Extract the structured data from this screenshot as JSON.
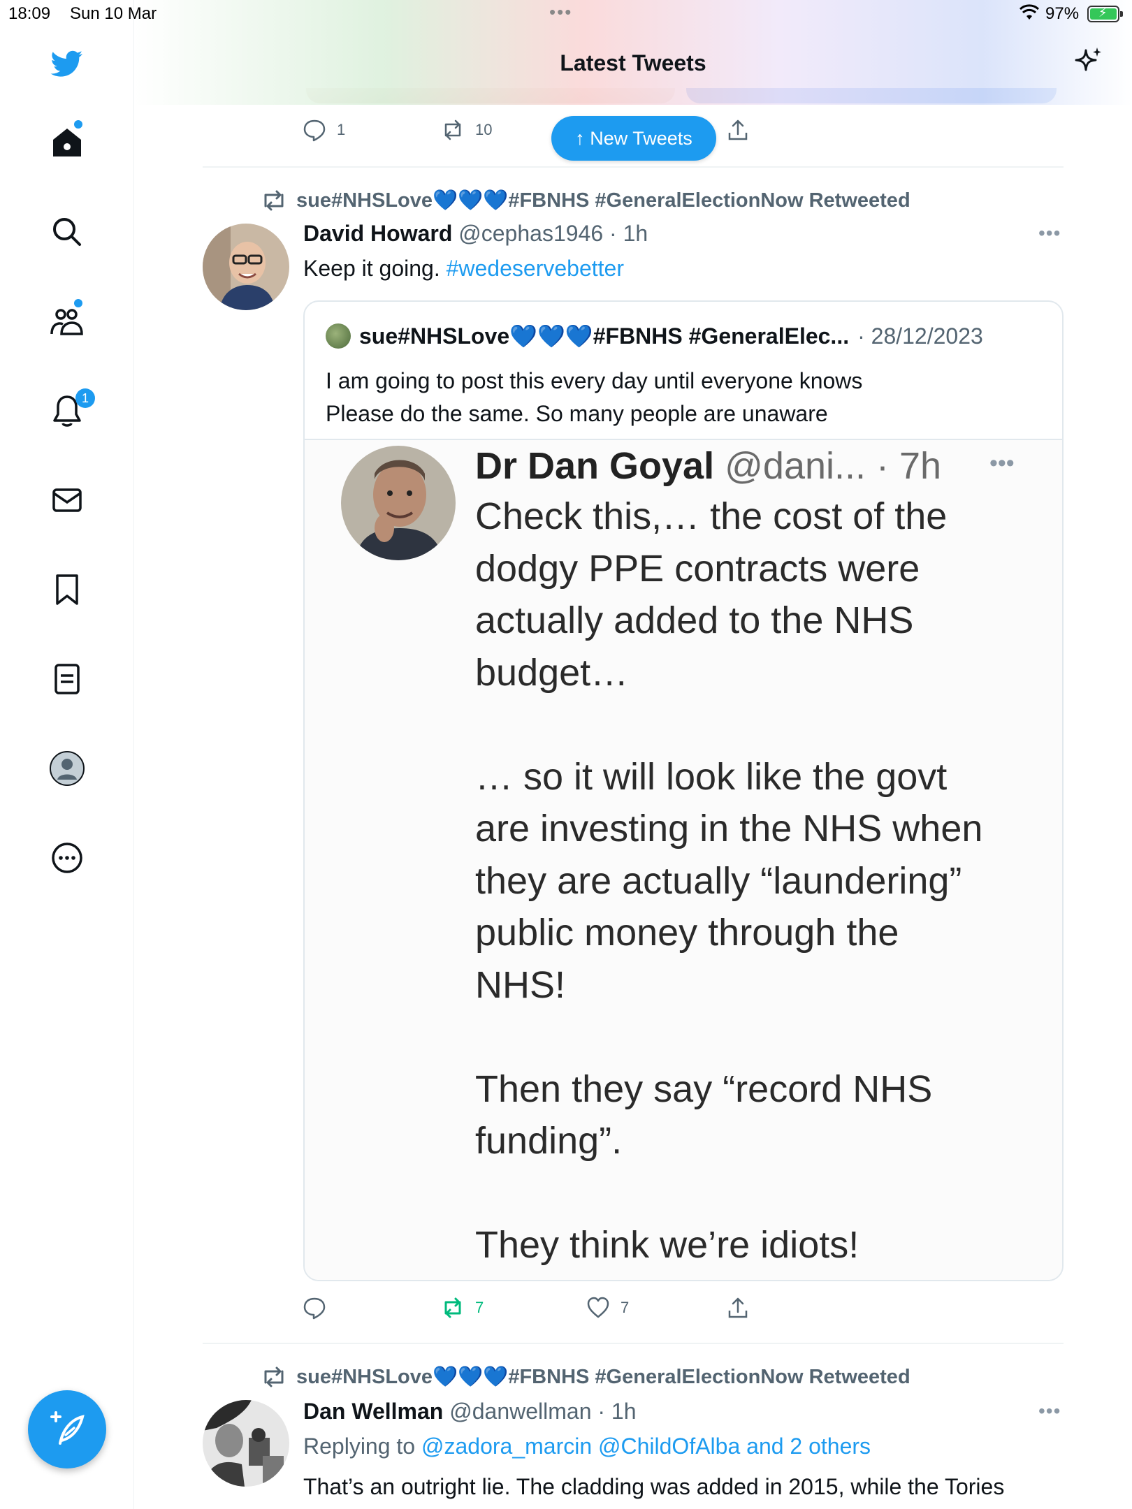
{
  "status": {
    "time": "18:09",
    "date": "Sun 10 Mar",
    "battery": "97%"
  },
  "header": {
    "title": "Latest Tweets"
  },
  "nav": {
    "notifications_badge": "1"
  },
  "new_tweets": "↑ New Tweets",
  "prev_tweet": {
    "replies": "1",
    "retweets": "10"
  },
  "tweet1": {
    "retweeted_by": "sue#NHSLove💙💙💙#FBNHS #GeneralElectionNow Retweeted",
    "name": "David Howard",
    "handle": "@cephas1946 · 1h",
    "text": "Keep it going.",
    "hashtag": "#wedeservebetter",
    "quote": {
      "name": "sue#NHSLove💙💙💙#FBNHS #GeneralElec...",
      "date": "· 28/12/2023",
      "line1": "I am going to post this every day until everyone knows",
      "line2": "Please do the same. So many people are unaware",
      "image": {
        "name": "Dr Dan Goyal",
        "handle": "@dani... · 7h",
        "body": "Check this,… the cost of the\ndodgy PPE contracts were\nactually added to the NHS\nbudget…\n\n… so it will look like the govt\nare investing in the NHS when\nthey are actually “laundering”\npublic money through the\nNHS!\n\nThen they say “record NHS\nfunding”.\n\nThey think we’re idiots!"
      }
    },
    "retweets": "7",
    "likes": "7"
  },
  "tweet2": {
    "retweeted_by": "sue#NHSLove💙💙💙#FBNHS #GeneralElectionNow Retweeted",
    "name": "Dan Wellman",
    "handle": "@danwellman · 1h",
    "replying_prefix": "Replying to",
    "replying_to": "@zadora_marcin @ChildOfAlba and 2 others",
    "text": "That’s an outright lie. The cladding was added in 2015, while the Tories"
  },
  "colors": {
    "accent": "#1d9bf0",
    "retweet_green": "#00ba7c",
    "muted": "#536471"
  }
}
